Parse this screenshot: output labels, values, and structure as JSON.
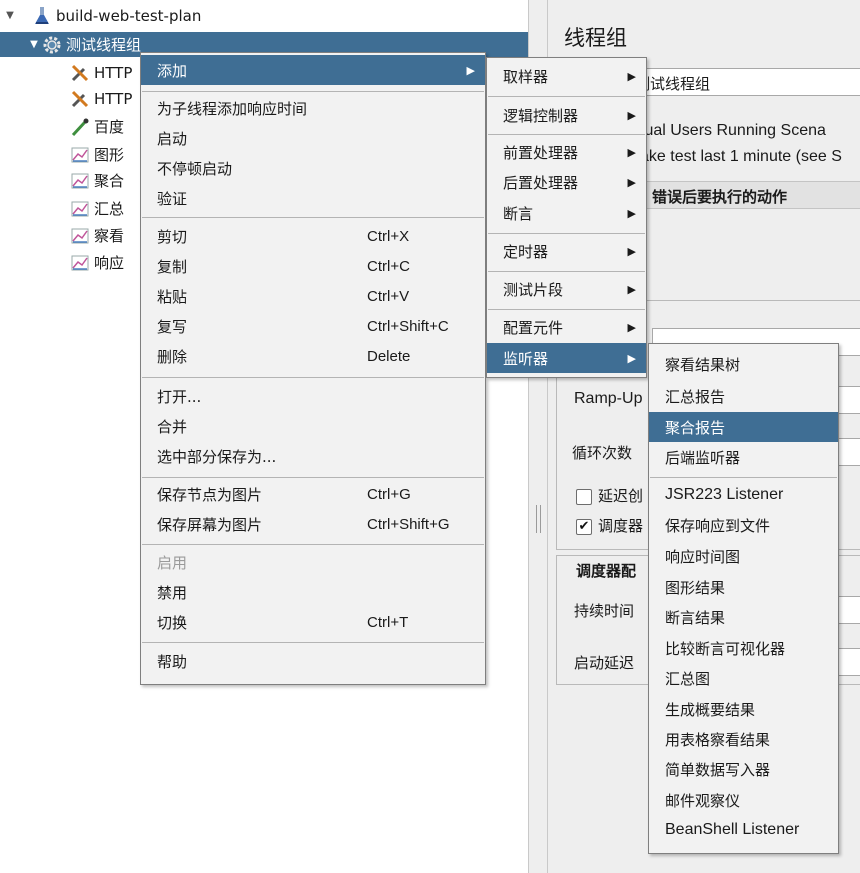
{
  "tree": {
    "items": [
      {
        "label": "build-web-test-plan",
        "icon": "flask-icon"
      },
      {
        "label": "测试线程组",
        "icon": "gear-icon"
      },
      {
        "label": "HTTP",
        "icon": "wrench-icon"
      },
      {
        "label": "HTTP",
        "icon": "wrench-icon"
      },
      {
        "label": "百度",
        "icon": "pipette-icon"
      },
      {
        "label": "图形",
        "icon": "chart-icon"
      },
      {
        "label": "聚合",
        "icon": "chart-icon"
      },
      {
        "label": "汇总",
        "icon": "chart-icon"
      },
      {
        "label": "察看",
        "icon": "chart-icon"
      },
      {
        "label": "响应",
        "icon": "chart-icon"
      }
    ]
  },
  "config": {
    "title": "线程组",
    "name_value": "测试线程组",
    "comment_line1": "tual Users Running Scena",
    "comment_line2": "ake test last 1 minute (see S",
    "error_action_header": "错误后要执行的动作",
    "rampup_label": "Ramp-Up",
    "loop_label": "循环次数",
    "delay_label": "延迟创",
    "delay_checked": false,
    "scheduler_label": "调度器",
    "scheduler_checked": true,
    "scheduler_section": "调度器配",
    "duration_label": "持续时间",
    "startup_delay_label": "启动延迟"
  },
  "context_menu": {
    "items": [
      {
        "label": "添加",
        "submenu": true
      },
      {
        "label": "为子线程添加响应时间"
      },
      {
        "label": "启动"
      },
      {
        "label": "不停顿启动"
      },
      {
        "label": "验证"
      },
      {
        "label": "剪切",
        "shortcut": "Ctrl+X"
      },
      {
        "label": "复制",
        "shortcut": "Ctrl+C"
      },
      {
        "label": "粘贴",
        "shortcut": "Ctrl+V"
      },
      {
        "label": "复写",
        "shortcut": "Ctrl+Shift+C"
      },
      {
        "label": "删除",
        "shortcut": "Delete"
      },
      {
        "label": "打开..."
      },
      {
        "label": "合并"
      },
      {
        "label": "选中部分保存为..."
      },
      {
        "label": "保存节点为图片",
        "shortcut": "Ctrl+G"
      },
      {
        "label": "保存屏幕为图片",
        "shortcut": "Ctrl+Shift+G"
      },
      {
        "label": "启用",
        "disabled": true
      },
      {
        "label": "禁用"
      },
      {
        "label": "切换",
        "shortcut": "Ctrl+T"
      },
      {
        "label": "帮助"
      }
    ]
  },
  "add_submenu": {
    "items": [
      {
        "label": "取样器"
      },
      {
        "label": "逻辑控制器"
      },
      {
        "label": "前置处理器"
      },
      {
        "label": "后置处理器"
      },
      {
        "label": "断言"
      },
      {
        "label": "定时器"
      },
      {
        "label": "测试片段"
      },
      {
        "label": "配置元件"
      },
      {
        "label": "监听器"
      }
    ]
  },
  "listener_submenu": {
    "items": [
      {
        "label": "察看结果树"
      },
      {
        "label": "汇总报告"
      },
      {
        "label": "聚合报告"
      },
      {
        "label": "后端监听器"
      },
      {
        "label": "JSR223 Listener"
      },
      {
        "label": "保存响应到文件"
      },
      {
        "label": "响应时间图"
      },
      {
        "label": "图形结果"
      },
      {
        "label": "断言结果"
      },
      {
        "label": "比较断言可视化器"
      },
      {
        "label": "汇总图"
      },
      {
        "label": "生成概要结果"
      },
      {
        "label": "用表格察看结果"
      },
      {
        "label": "简单数据写入器"
      },
      {
        "label": "邮件观察仪"
      },
      {
        "label": "BeanShell Listener"
      }
    ]
  },
  "colors": {
    "selection": "#3f6e94",
    "menu_bg": "#f2f2f2",
    "panel_bg": "#eeeeee"
  }
}
